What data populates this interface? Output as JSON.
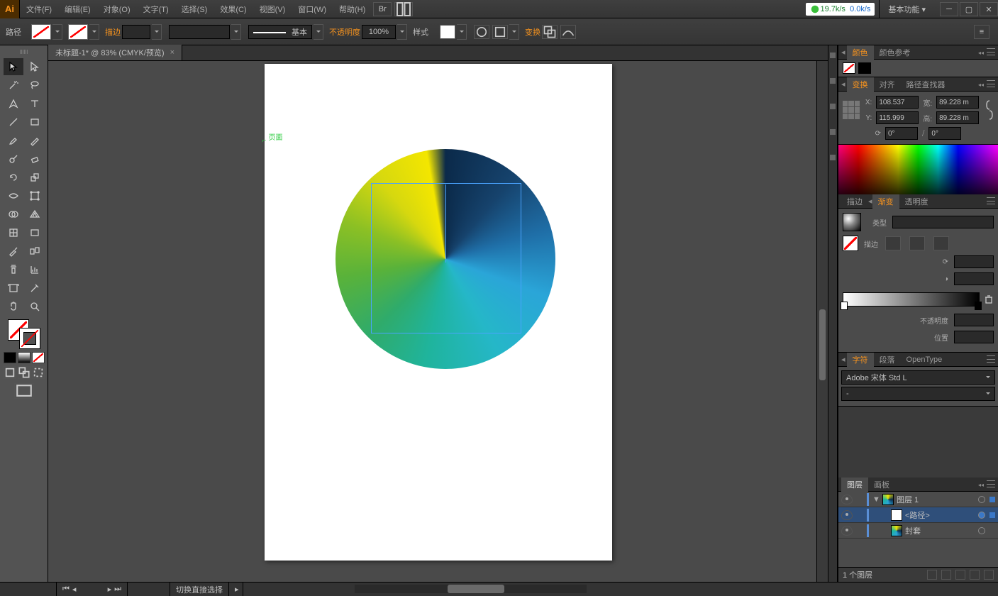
{
  "app_badge": "Ai",
  "menus": [
    "文件(F)",
    "编辑(E)",
    "对象(O)",
    "文字(T)",
    "选择(S)",
    "效果(C)",
    "视图(V)",
    "窗口(W)",
    "帮助(H)"
  ],
  "netstat_up": "19.7k/s",
  "netstat_dn": "0.0k/s",
  "workspace": "基本功能",
  "control": {
    "selection_label": "路径",
    "stroke_label": "描边",
    "stroke_pt": "",
    "stroke_style": "基本",
    "opacity_label": "不透明度",
    "opacity_value": "100%",
    "style_label": "样式",
    "transform_label": "变换"
  },
  "doc_tab": "未标题-1* @ 83% (CMYK/预览)",
  "page_label": "页面",
  "color_tabs": [
    "颜色",
    "颜色参考"
  ],
  "transform_tabs": [
    "变换",
    "对齐",
    "路径查找器"
  ],
  "transform": {
    "x_label": "X:",
    "x": "108.537",
    "y_label": "Y:",
    "y": "115.999",
    "w_label": "宽:",
    "w": "89.228 m",
    "h_label": "高:",
    "h": "89.228 m",
    "r1": "0°",
    "r2": "0°"
  },
  "grad_tabs": [
    "描边",
    "渐变",
    "透明度"
  ],
  "grad": {
    "type_label": "类型",
    "stroke_label": "描边",
    "opacity_label": "不透明度",
    "position_label": "位置"
  },
  "type_tabs": [
    "字符",
    "段落",
    "OpenType"
  ],
  "font_family": "Adobe 宋体 Std L",
  "font_style": "-",
  "layer_tabs": [
    "图层",
    "画板"
  ],
  "layers": [
    {
      "name": "图层 1",
      "thumb": "l1",
      "indent": 0,
      "twisty": "▼",
      "selected": false
    },
    {
      "name": "<路径>",
      "thumb": "path",
      "indent": 1,
      "twisty": "",
      "selected": true
    },
    {
      "name": "封套",
      "thumb": "env",
      "indent": 1,
      "twisty": "",
      "selected": false
    }
  ],
  "layer_footer": "1 个图层",
  "status": {
    "tool": "切换直接选择"
  }
}
